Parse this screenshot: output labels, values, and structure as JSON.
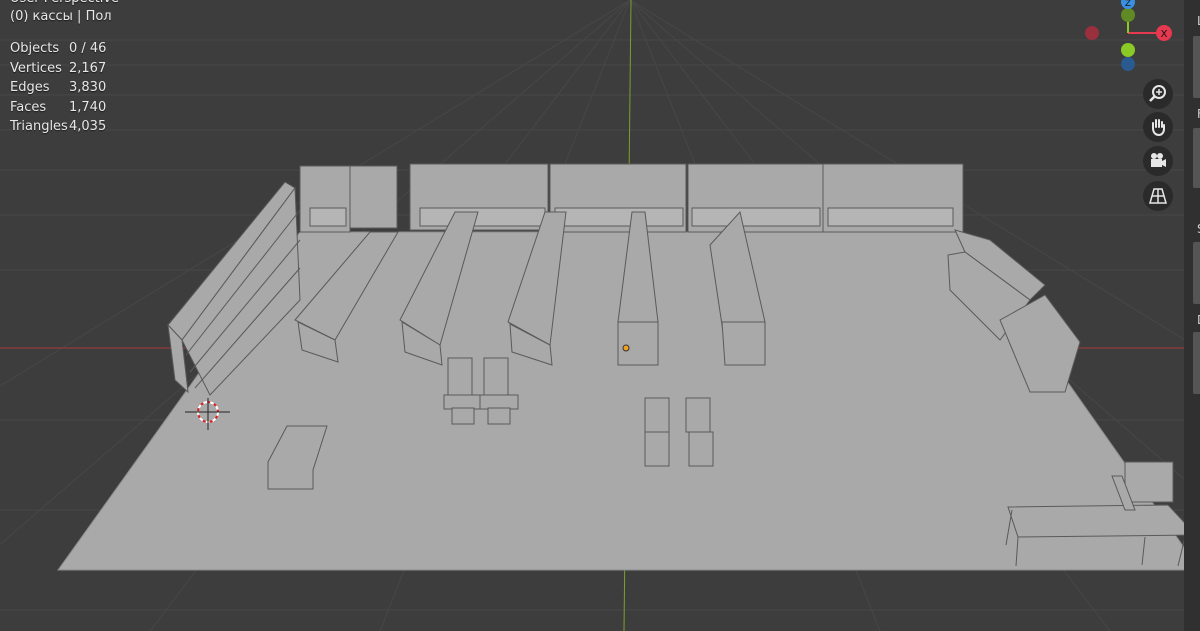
{
  "viewport": {
    "view_name": "User Perspective",
    "collection": "(0) кассы | Пол"
  },
  "stats": [
    {
      "label": "Objects",
      "value": "0 / 46"
    },
    {
      "label": "Vertices",
      "value": "2,167"
    },
    {
      "label": "Edges",
      "value": "3,830"
    },
    {
      "label": "Faces",
      "value": "1,740"
    },
    {
      "label": "Triangles",
      "value": "4,035"
    }
  ],
  "gizmo": {
    "z_label": "Z",
    "x_label": "X",
    "colors": {
      "x": "#e5394f",
      "y": "#8ac926",
      "z": "#3a8fe0",
      "neg_x": "#9a2f3e",
      "neg_y": "#5f8a24",
      "neg_z": "#2a5a90"
    }
  },
  "nav": [
    {
      "icon": "zoom-icon"
    },
    {
      "icon": "hand-pan-icon"
    },
    {
      "icon": "camera-icon"
    },
    {
      "icon": "grid-perspective-icon"
    }
  ],
  "side_panel": {
    "letters": [
      "L",
      "F",
      "S",
      "D"
    ]
  },
  "colors": {
    "background": "#3d3d3d",
    "grid": "#474747",
    "x_axis": "#a83a3a",
    "y_axis": "#7aa12a",
    "mesh": "#a9a9a9",
    "mesh_dark": "#7c7c7c",
    "mesh_edge": "#5a5a5a"
  }
}
